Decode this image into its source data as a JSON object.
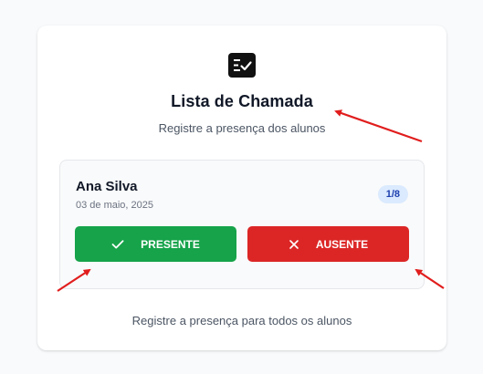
{
  "header": {
    "icon": "checklist-icon",
    "title": "Lista de Chamada",
    "subtitle": "Registre a presença dos alunos"
  },
  "student": {
    "name": "Ana Silva",
    "date": "03 de maio, 2025",
    "counter": "1/8"
  },
  "actions": {
    "present_label": "PRESENTE",
    "present_icon": "check-icon",
    "absent_label": "AUSENTE",
    "absent_icon": "close-icon"
  },
  "footer": {
    "text": "Registre a presença para todos os alunos"
  },
  "colors": {
    "present": "#16a34a",
    "absent": "#dc2626",
    "badge_bg": "#dbeafe",
    "badge_text": "#1e40af",
    "annotation_arrow": "#e11d1d"
  }
}
